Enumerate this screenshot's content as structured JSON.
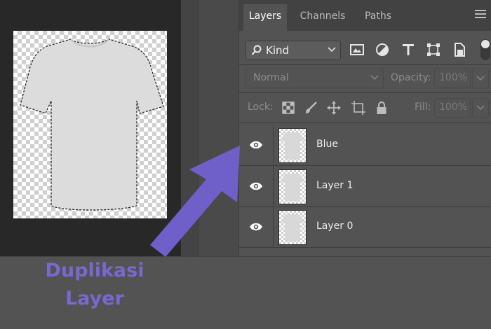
{
  "tabs": [
    {
      "label": "Layers",
      "active": true
    },
    {
      "label": "Channels",
      "active": false
    },
    {
      "label": "Paths",
      "active": false
    }
  ],
  "filter": {
    "kind_label": "Kind",
    "icons": [
      "image-filter-icon",
      "adjustment-filter-icon",
      "type-filter-icon",
      "shape-filter-icon",
      "smart-object-filter-icon"
    ]
  },
  "blend": {
    "mode": "Normal",
    "opacity_label": "Opacity:",
    "opacity_value": "100%"
  },
  "lock": {
    "label": "Lock:",
    "fill_label": "Fill:",
    "fill_value": "100%"
  },
  "layers": [
    {
      "name": "Blue",
      "visible": true
    },
    {
      "name": "Layer 1",
      "visible": true
    },
    {
      "name": "Layer 0",
      "visible": true
    }
  ],
  "annotation": {
    "line1": "Duplikasi",
    "line2": "Layer",
    "color": "#7262cc"
  },
  "colors": {
    "panel_bg": "#535353",
    "canvas_bg": "#282828",
    "accent": "#7262cc"
  }
}
